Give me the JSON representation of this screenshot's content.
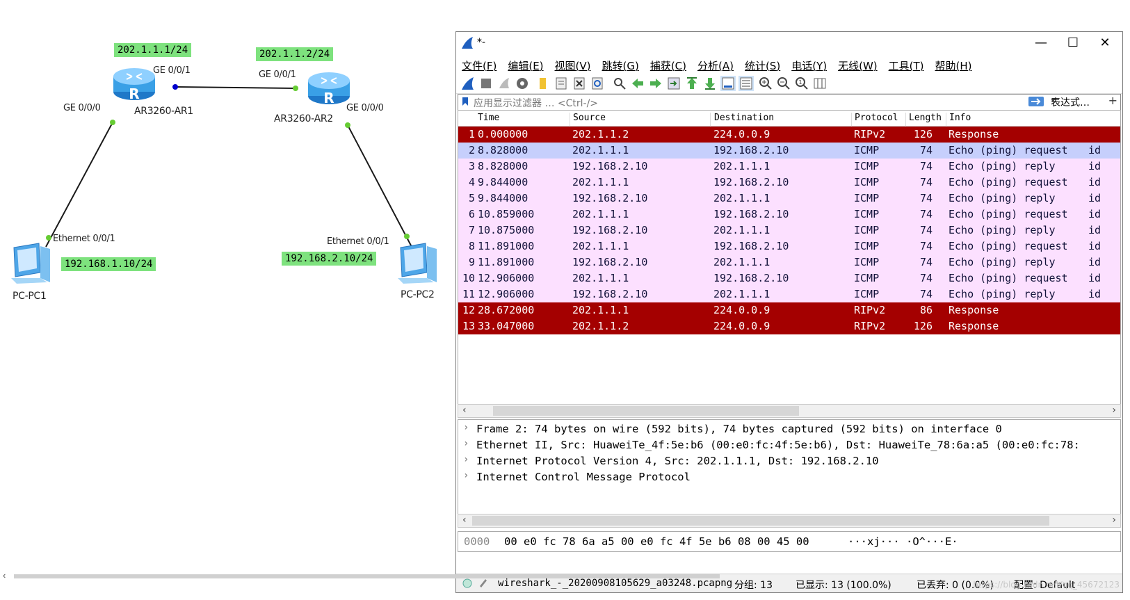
{
  "topology": {
    "devices": {
      "ar1": "AR3260-AR1",
      "ar2": "AR3260-AR2",
      "pc1": "PC-PC1",
      "pc2": "PC-PC2"
    },
    "ips": {
      "ar1_wan": "202.1.1.1/24",
      "ar2_wan": "202.1.1.2/24",
      "pc1": "192.168.1.10/24",
      "pc2": "192.168.2.10/24"
    },
    "ports": {
      "ar1_ge001": "GE 0/0/1",
      "ar1_ge000": "GE 0/0/0",
      "ar2_ge001": "GE 0/0/1",
      "ar2_ge000": "GE 0/0/0",
      "pc1_eth": "Ethernet 0/0/1",
      "pc2_eth": "Ethernet 0/0/1"
    },
    "colors": {
      "ip_label_bg": "#7ee27e",
      "link": "#1a1a1a",
      "router_blue": "#3aa0e6"
    }
  },
  "wireshark": {
    "title": "*-",
    "window_buttons": {
      "minimize": "—",
      "maximize": "☐",
      "close": "✕"
    },
    "menu": [
      "文件(F)",
      "编辑(E)",
      "视图(V)",
      "跳转(G)",
      "捕获(C)",
      "分析(A)",
      "统计(S)",
      "电话(Y)",
      "无线(W)",
      "工具(T)",
      "帮助(H)"
    ],
    "filter": {
      "placeholder": "应用显示过滤器 … <Ctrl-/>",
      "expression_label": "表达式…",
      "add_label": "+"
    },
    "columns": [
      "Time",
      "Source",
      "Destination",
      "Protocol",
      "Length",
      "Info"
    ],
    "packets": [
      {
        "no": "1",
        "time": "0.000000",
        "src": "202.1.1.2",
        "dst": "224.0.0.9",
        "proto": "RIPv2",
        "len": "126",
        "info": "Response",
        "extra": "",
        "style": "rip"
      },
      {
        "no": "2",
        "time": "8.828000",
        "src": "202.1.1.1",
        "dst": "192.168.2.10",
        "proto": "ICMP",
        "len": "74",
        "info": "Echo (ping) request",
        "extra": "id",
        "style": "selected"
      },
      {
        "no": "3",
        "time": "8.828000",
        "src": "192.168.2.10",
        "dst": "202.1.1.1",
        "proto": "ICMP",
        "len": "74",
        "info": "Echo (ping) reply",
        "extra": "id",
        "style": "icmp"
      },
      {
        "no": "4",
        "time": "9.844000",
        "src": "202.1.1.1",
        "dst": "192.168.2.10",
        "proto": "ICMP",
        "len": "74",
        "info": "Echo (ping) request",
        "extra": "id",
        "style": "icmp"
      },
      {
        "no": "5",
        "time": "9.844000",
        "src": "192.168.2.10",
        "dst": "202.1.1.1",
        "proto": "ICMP",
        "len": "74",
        "info": "Echo (ping) reply",
        "extra": "id",
        "style": "icmp"
      },
      {
        "no": "6",
        "time": "10.859000",
        "src": "202.1.1.1",
        "dst": "192.168.2.10",
        "proto": "ICMP",
        "len": "74",
        "info": "Echo (ping) request",
        "extra": "id",
        "style": "icmp"
      },
      {
        "no": "7",
        "time": "10.875000",
        "src": "192.168.2.10",
        "dst": "202.1.1.1",
        "proto": "ICMP",
        "len": "74",
        "info": "Echo (ping) reply",
        "extra": "id",
        "style": "icmp"
      },
      {
        "no": "8",
        "time": "11.891000",
        "src": "202.1.1.1",
        "dst": "192.168.2.10",
        "proto": "ICMP",
        "len": "74",
        "info": "Echo (ping) request",
        "extra": "id",
        "style": "icmp"
      },
      {
        "no": "9",
        "time": "11.891000",
        "src": "192.168.2.10",
        "dst": "202.1.1.1",
        "proto": "ICMP",
        "len": "74",
        "info": "Echo (ping) reply",
        "extra": "id",
        "style": "icmp"
      },
      {
        "no": "10",
        "time": "12.906000",
        "src": "202.1.1.1",
        "dst": "192.168.2.10",
        "proto": "ICMP",
        "len": "74",
        "info": "Echo (ping) request",
        "extra": "id",
        "style": "icmp"
      },
      {
        "no": "11",
        "time": "12.906000",
        "src": "192.168.2.10",
        "dst": "202.1.1.1",
        "proto": "ICMP",
        "len": "74",
        "info": "Echo (ping) reply",
        "extra": "id",
        "style": "icmp"
      },
      {
        "no": "12",
        "time": "28.672000",
        "src": "202.1.1.1",
        "dst": "224.0.0.9",
        "proto": "RIPv2",
        "len": "86",
        "info": "Response",
        "extra": "",
        "style": "rip"
      },
      {
        "no": "13",
        "time": "33.047000",
        "src": "202.1.1.2",
        "dst": "224.0.0.9",
        "proto": "RIPv2",
        "len": "126",
        "info": "Response",
        "extra": "",
        "style": "rip"
      }
    ],
    "row_colors": {
      "rip": {
        "bg": "#a40000",
        "fg": "#fffcfc"
      },
      "selected": {
        "bg": "#c6cffc",
        "fg": "#12123a"
      },
      "icmp": {
        "bg": "#fce0ff",
        "fg": "#12123a"
      }
    },
    "details": [
      "Frame 2: 74 bytes on wire (592 bits), 74 bytes captured (592 bits) on interface 0",
      "Ethernet II, Src: HuaweiTe_4f:5e:b6 (00:e0:fc:4f:5e:b6), Dst: HuaweiTe_78:6a:a5 (00:e0:fc:78:",
      "Internet Protocol Version 4, Src: 202.1.1.1, Dst: 192.168.2.10",
      "Internet Control Message Protocol"
    ],
    "bytes": {
      "offset": "0000",
      "hex": "00 e0 fc 78 6a a5 00 e0  fc 4f 5e b6 08 00 45 00",
      "ascii": "···xj··· ·O^···E·"
    },
    "status": {
      "file": "wireshark_-_20200908105629_a03248.pcapng",
      "packets": "分组: 13",
      "displayed": "已显示: 13 (100.0%)",
      "dropped": "已丢弃: 0 (0.0%)",
      "profile": "配置: Default"
    },
    "watermark": "https://blog.csdn.net/qq_45672123"
  }
}
